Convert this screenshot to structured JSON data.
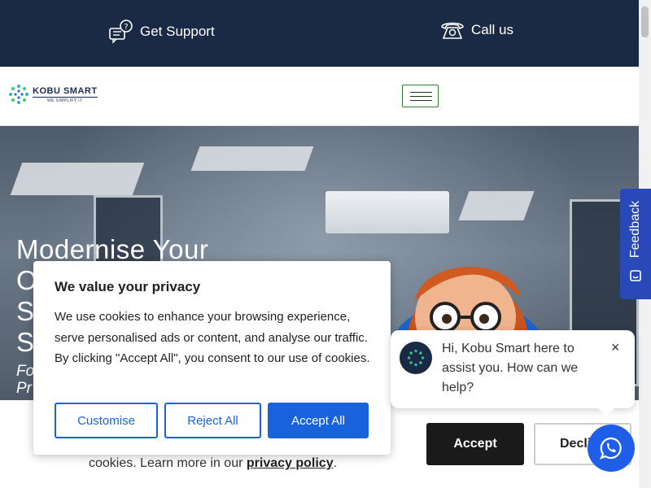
{
  "topbar": {
    "support_label": "Get Support",
    "support_icon": "support-chat-icon",
    "call_label": "Call us",
    "call_icon": "phone-icon",
    "background": "#1b2a44"
  },
  "header": {
    "logo_name": "KOBU SMART",
    "logo_tagline": "WE SIMPLIFY IT",
    "menu_icon": "hamburger-icon"
  },
  "hero": {
    "title_lines": [
      "Modernise Your",
      "O",
      "S",
      "S"
    ],
    "subtitle_lines": [
      "Fo",
      "Pr"
    ]
  },
  "feedback": {
    "label": "Feedback",
    "color": "#2a49b8"
  },
  "consent": {
    "title": "We value your privacy",
    "body": "We use cookies to enhance your browsing experience, serve personalised ads or content, and analyse our traffic. By clicking \"Accept All\", you consent to our use of cookies.",
    "customise_label": "Customise",
    "reject_label": "Reject All",
    "accept_label": "Accept All",
    "accent": "#1863dc"
  },
  "cookie_bar": {
    "text_prefix": "cookies. Learn more in our ",
    "link_label": "privacy policy",
    "text_suffix": ".",
    "accept_label": "Accept",
    "decline_label": "Decli"
  },
  "chat": {
    "message": "Hi, Kobu Smart here to assist you. How can we help?",
    "close_label": "×",
    "whatsapp_icon": "whatsapp-icon"
  }
}
